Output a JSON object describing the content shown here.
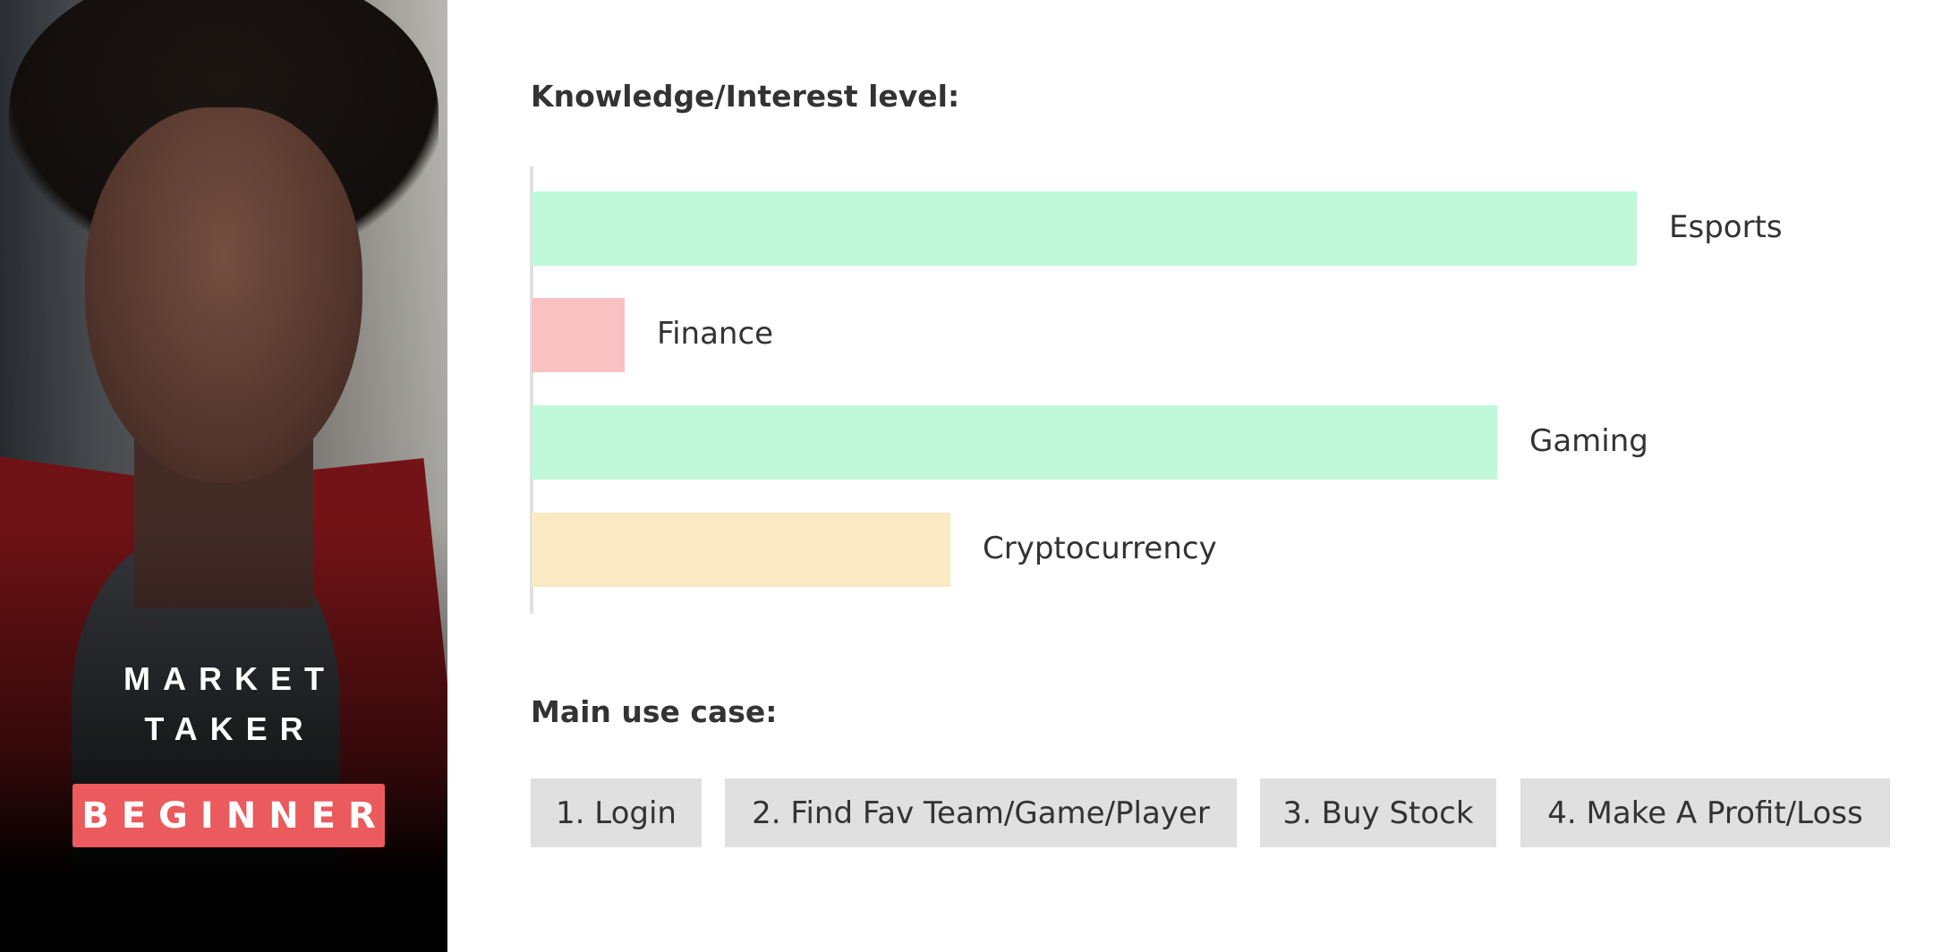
{
  "persona": {
    "title_line1": "MARKET",
    "title_line2": "TAKER",
    "level": "BEGINNER",
    "level_color": "#eb5a5c"
  },
  "knowledge_heading": "Knowledge/Interest level:",
  "chart_data": {
    "type": "bar",
    "orientation": "horizontal",
    "categories": [
      "Esports",
      "Finance",
      "Gaming",
      "Cryptocurrency"
    ],
    "values": [
      95,
      8,
      83,
      36
    ],
    "colors": [
      "#bff9d9",
      "#f9c1c1",
      "#bff9d9",
      "#faeac3"
    ],
    "xlim": [
      0,
      100
    ],
    "title": "Knowledge/Interest level:"
  },
  "use_case_heading": "Main use case:",
  "use_cases": [
    "1. Login",
    "2. Find Fav Team/Game/Player",
    "3. Buy Stock",
    "4. Make A Profit/Loss"
  ]
}
